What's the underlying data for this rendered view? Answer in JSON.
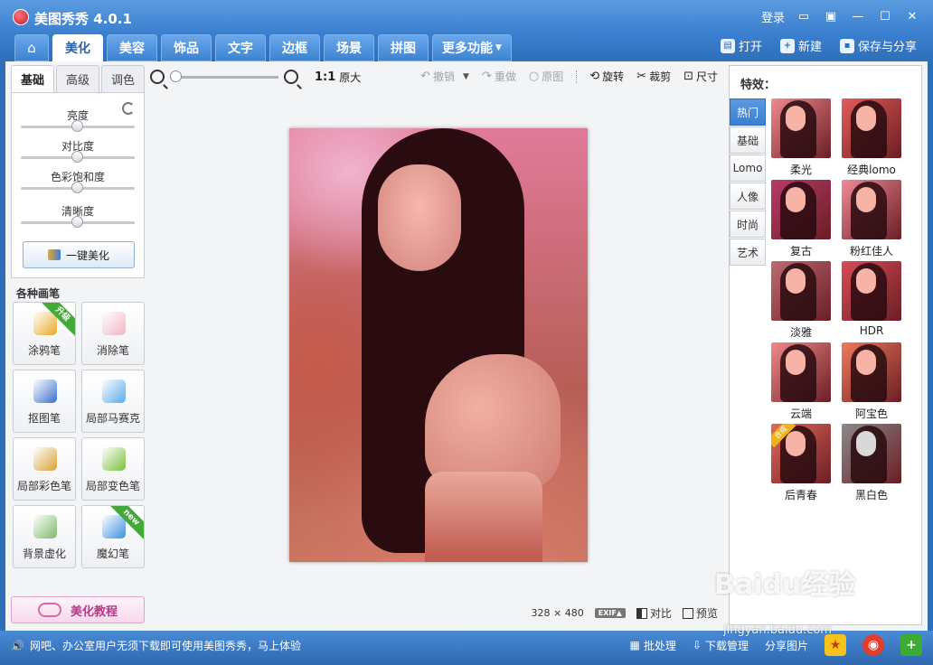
{
  "window": {
    "title": "美图秀秀 4.0.1",
    "login": "登录"
  },
  "main_tabs": [
    {
      "label": "美化",
      "active": true
    },
    {
      "label": "美容"
    },
    {
      "label": "饰品"
    },
    {
      "label": "文字"
    },
    {
      "label": "边框"
    },
    {
      "label": "场景"
    },
    {
      "label": "拼图"
    },
    {
      "label": "更多功能"
    }
  ],
  "top_actions": {
    "open": "打开",
    "new": "新建",
    "save_share": "保存与分享"
  },
  "left": {
    "sub_tabs": [
      "基础",
      "高级",
      "调色"
    ],
    "sliders": [
      {
        "label": "亮度",
        "level": 0.5
      },
      {
        "label": "对比度",
        "level": 0.5
      },
      {
        "label": "色彩饱和度",
        "level": 0.5
      },
      {
        "label": "清晰度",
        "level": 0.5
      }
    ],
    "one_click": "一键美化",
    "brush_title": "各种画笔",
    "brushes": [
      {
        "label": "涂鸦笔",
        "badge": "升级",
        "color": "#e8a92a"
      },
      {
        "label": "消除笔",
        "color": "#f2b5c4"
      },
      {
        "label": "抠图笔",
        "color": "#3a6fd0"
      },
      {
        "label": "局部马赛克",
        "color": "#5aa9e8"
      },
      {
        "label": "局部彩色笔",
        "color": "#d9a233"
      },
      {
        "label": "局部变色笔",
        "color": "#7cbf3c"
      },
      {
        "label": "背景虚化",
        "color": "#7fb86a"
      },
      {
        "label": "魔幻笔",
        "badge": "new",
        "color": "#3b8fe0"
      }
    ],
    "tutorial": "美化教程"
  },
  "toolbar": {
    "orig_ratio": "1:1",
    "orig_label": "原大",
    "undo": "撤销",
    "redo": "重做",
    "original": "原图",
    "rotate": "旋转",
    "crop": "裁剪",
    "size": "尺寸"
  },
  "status": {
    "width": "328",
    "times": "×",
    "height": "480",
    "exif": "EXIF▲",
    "compare": "对比",
    "preview": "预览"
  },
  "effects": {
    "title": "特效：",
    "categories": [
      "热门",
      "基础",
      "Lomo",
      "人像",
      "时尚",
      "艺术"
    ],
    "items": [
      {
        "label": "柔光",
        "tint": "#f08a8f"
      },
      {
        "label": "经典lomo",
        "tint": "#e35c58"
      },
      {
        "label": "复古",
        "tint": "#b83a6a"
      },
      {
        "label": "粉红佳人",
        "tint": "#f08a96"
      },
      {
        "label": "淡雅",
        "tint": "#c06a72"
      },
      {
        "label": "HDR",
        "tint": "#d84c55"
      },
      {
        "label": "云端",
        "tint": "#f08a8a"
      },
      {
        "label": "阿宝色",
        "tint": "#ef7a5a"
      },
      {
        "label": "后青春",
        "tint": "#e36a5a",
        "badge": "合成"
      },
      {
        "label": "黑白色",
        "tint": "#8a8a8a"
      }
    ]
  },
  "bottom": {
    "message": "网吧、办公室用户无须下载即可使用美图秀秀，马上体验",
    "batch": "批处理",
    "download": "下载管理",
    "share": "分享图片"
  },
  "watermark": {
    "text": "Baidu经验",
    "url": "jingyan.baidu.com"
  },
  "colors": {
    "accent": "#3a7fcf",
    "panel": "#f3f4f6"
  }
}
